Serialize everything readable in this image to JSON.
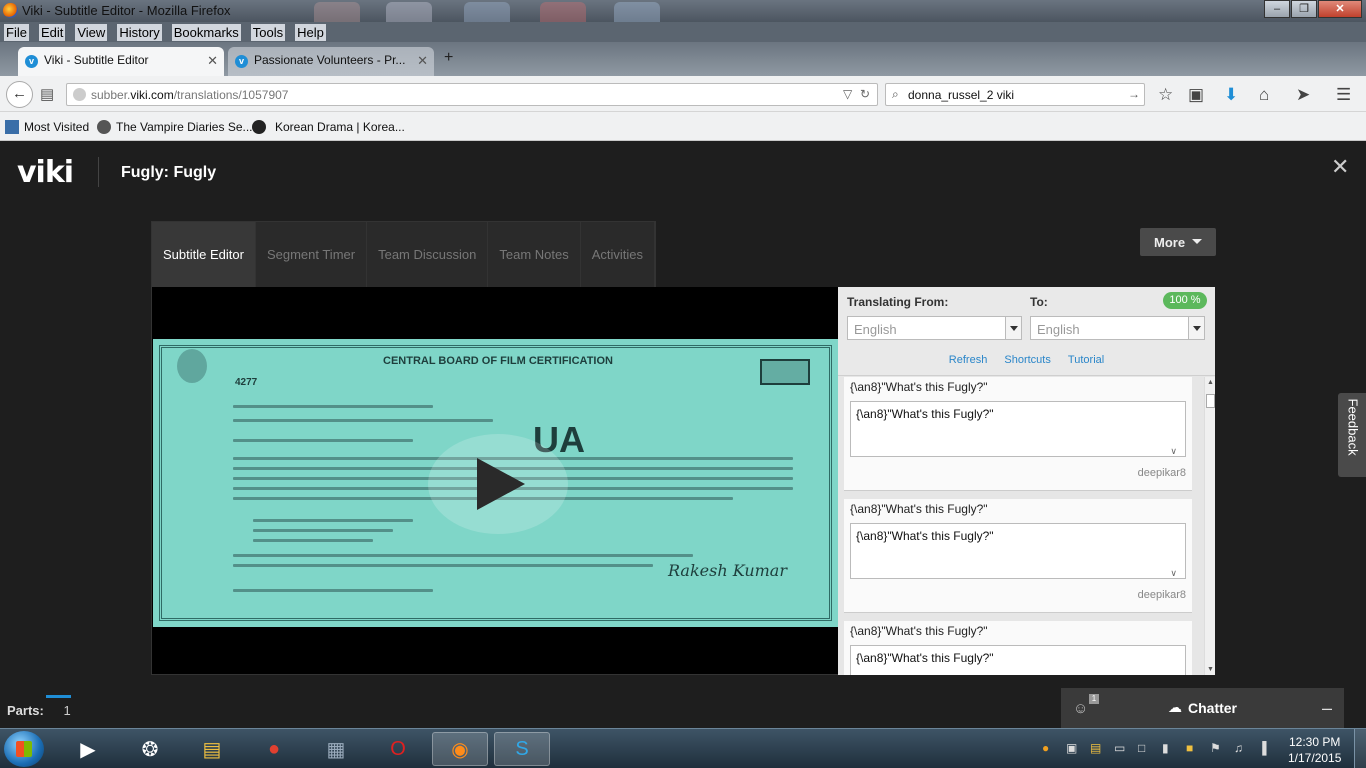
{
  "window": {
    "title": "Viki - Subtitle Editor - Mozilla Firefox"
  },
  "menubar": [
    "File",
    "Edit",
    "View",
    "History",
    "Bookmarks",
    "Tools",
    "Help"
  ],
  "tabs": [
    {
      "label": "Viki - Subtitle Editor",
      "active": true
    },
    {
      "label": "Passionate Volunteers - Pr...",
      "active": false
    }
  ],
  "navbar": {
    "url_prefix": "subber.",
    "url_domain": "viki.com",
    "url_path": "/translations/1057907",
    "search_query": "donna_russel_2 viki"
  },
  "bookmarks": [
    "Most Visited",
    "The Vampire Diaries Se...",
    "Korean Drama | Korea..."
  ],
  "viki": {
    "logo": "viki",
    "show_title": "Fugly: Fugly",
    "tabs": [
      "Subtitle Editor",
      "Segment Timer",
      "Team Discussion",
      "Team Notes",
      "Activities"
    ],
    "more_label": "More",
    "translate": {
      "from_label": "Translating From:",
      "to_label": "To:",
      "progress": "100 %",
      "from_value": "English",
      "to_value": "English",
      "links": [
        "Refresh",
        "Shortcuts",
        "Tutorial"
      ]
    },
    "segments": [
      {
        "source": "{\\an8}\"What's this Fugly?\"",
        "translation": "{\\an8}\"What's this Fugly?\"",
        "author": "deepikar8"
      },
      {
        "source": "{\\an8}\"What's this Fugly?\"",
        "translation": "{\\an8}\"What's this Fugly?\"",
        "author": "deepikar8"
      },
      {
        "source": "{\\an8}\"What's this Fugly?\"",
        "translation": "{\\an8}\"What's this Fugly?\"",
        "author": ""
      }
    ],
    "feedback_label": "Feedback",
    "parts_label": "Parts:",
    "parts_value": "1",
    "chatter_label": "Chatter",
    "chatter_count": "1"
  },
  "video": {
    "cert_heading": "CENTRAL BOARD OF FILM CERTIFICATION",
    "cert_number": "4277",
    "rating": "UA"
  },
  "taskbar": {
    "time": "12:30 PM",
    "date": "1/17/2015"
  },
  "colors": {
    "accent": "#1f8ed6",
    "progress": "#5cb85c",
    "link": "#2a86c9"
  }
}
